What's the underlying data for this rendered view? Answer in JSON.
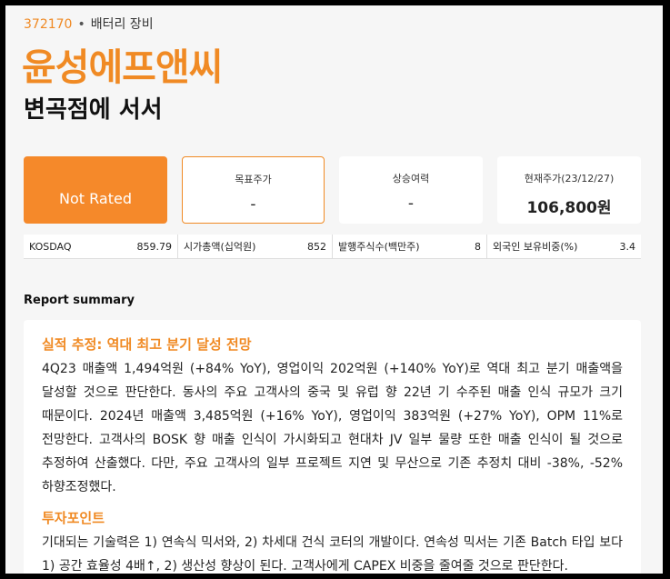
{
  "header": {
    "code": "372170",
    "sector": "배터리 장비",
    "company": "윤성에프앤씨",
    "headline": "변곡점에 서서"
  },
  "boxes": {
    "rating": "Not Rated",
    "target_label": "목표주가",
    "target_value": "-",
    "upside_label": "상승여력",
    "upside_value": "-",
    "price_label": "현재주가(23/12/27)",
    "price_value": "106,800원"
  },
  "stats": [
    {
      "label": "KOSDAQ",
      "value": "859.79"
    },
    {
      "label": "시가총액(십억원)",
      "value": "852"
    },
    {
      "label": "발행주식수(백만주)",
      "value": "8"
    },
    {
      "label": "외국인 보유비중(%)",
      "value": "3.4"
    }
  ],
  "summary": {
    "title": "Report summary",
    "section1_title": "실적 추정: 역대 최고 분기 달성 전망",
    "section1_text": "4Q23 매출액 1,494억원 (+84% YoY), 영업이익 202억원 (+140% YoY)로 역대 최고 분기 매출액을 달성할 것으로 판단한다. 동사의 주요 고객사의 중국 및 유럽 향 22년 기 수주된 매출 인식 규모가 크기 때문이다. 2024년 매출액 3,485억원 (+16% YoY), 영업이익 383억원 (+27% YoY), OPM 11%로 전망한다. 고객사의 BOSK 향 매출 인식이 가시화되고 현대차 JV 일부 물량 또한 매출 인식이 될 것으로 추정하여 산출했다. 다만, 주요 고객사의 일부 프로젝트 지연 및 무산으로 기존 추정치 대비 -38%, -52% 하향조정했다.",
    "section2_title": "투자포인트",
    "section2_text": "기대되는 기술력은 1) 연속식 믹서와, 2) 차세대 건식 코터의 개발이다. 연속성 믹서는 기존 Batch 타입 보다 1) 공간 효율성 4배↑, 2) 생산성 향상이 된다. 고객사에게 CAPEX 비중을 줄여줄 것으로 판단한다."
  }
}
